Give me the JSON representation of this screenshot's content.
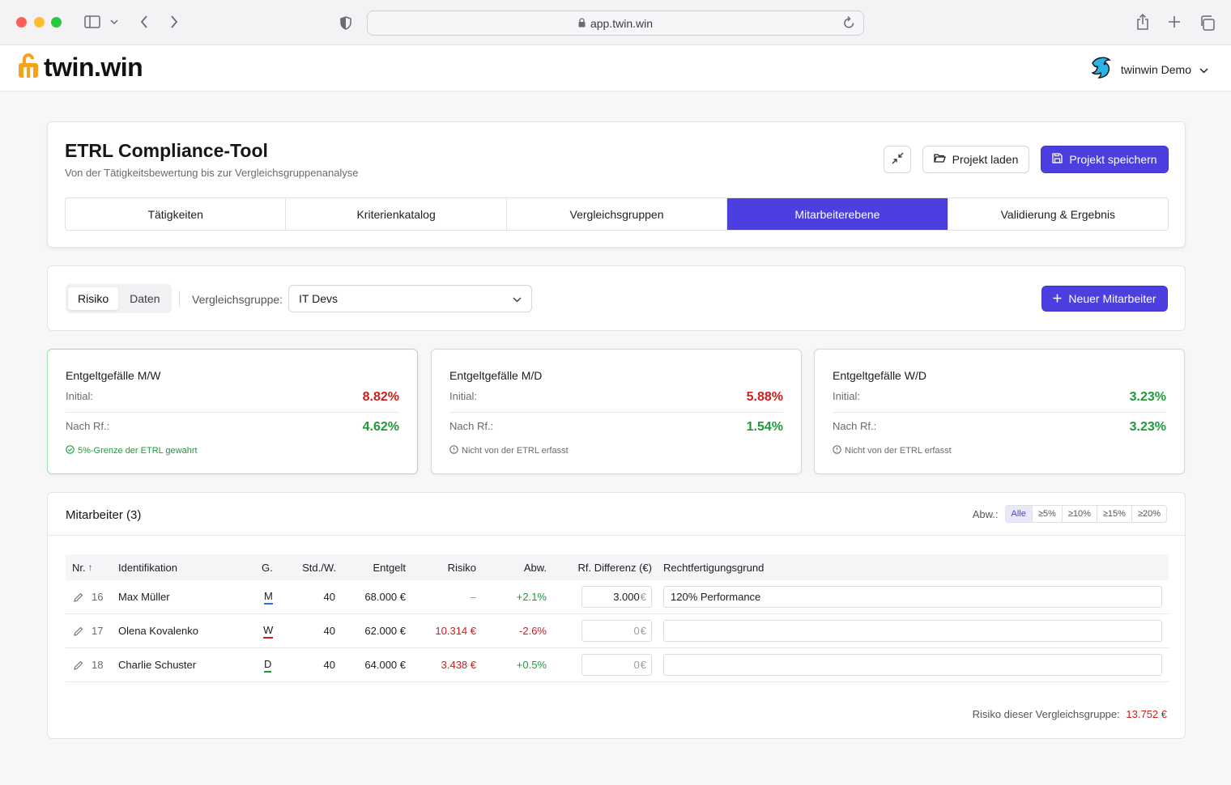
{
  "browser": {
    "url": "app.twin.win"
  },
  "app": {
    "logo_text": "twin.win",
    "user_name": "twinwin Demo"
  },
  "tool": {
    "title": "ETRL Compliance-Tool",
    "subtitle": "Von der Tätigkeitsbewertung bis zur Vergleichsgruppenanalyse",
    "load_label": "Projekt laden",
    "save_label": "Projekt speichern",
    "tabs": [
      "Tätigkeiten",
      "Kriterienkatalog",
      "Vergleichsgruppen",
      "Mitarbeiterebene",
      "Validierung & Ergebnis"
    ],
    "active_tab": "Mitarbeiterebene"
  },
  "controls": {
    "seg_risk": "Risiko",
    "seg_data": "Daten",
    "group_label": "Vergleichsgruppe:",
    "group_value": "IT Devs",
    "new_employee": "Neuer Mitarbeiter"
  },
  "kpis": [
    {
      "title": "Entgeltgefälle M/W",
      "initial_label": "Initial:",
      "initial_value": "8.82%",
      "after_label": "Nach Rf.:",
      "after_value": "4.62%",
      "note": "5%-Grenze der ETRL gewahrt"
    },
    {
      "title": "Entgeltgefälle M/D",
      "initial_label": "Initial:",
      "initial_value": "5.88%",
      "after_label": "Nach Rf.:",
      "after_value": "1.54%",
      "note": "Nicht von der ETRL erfasst"
    },
    {
      "title": "Entgeltgefälle W/D",
      "initial_label": "Initial:",
      "initial_value": "3.23%",
      "after_label": "Nach Rf.:",
      "after_value": "3.23%",
      "note": "Nicht von der ETRL erfasst"
    }
  ],
  "colors": {
    "accent": "#4c3fe0",
    "danger": "#d11c1c",
    "success": "#1f9a3b"
  },
  "employees": {
    "title": "Mitarbeiter (3)",
    "filter_label": "Abw.:",
    "filters": [
      "Alle",
      "≥5%",
      "≥10%",
      "≥15%",
      "≥20%"
    ],
    "headers": {
      "nr": "Nr.",
      "sort": "↑",
      "id": "Identifikation",
      "g": "G.",
      "hours": "Std./W.",
      "pay": "Entgelt",
      "risk": "Risiko",
      "dev": "Abw.",
      "rf": "Rf. Differenz (€)",
      "reason": "Rechtfertigungsgrund"
    },
    "rows": [
      {
        "nr": "16",
        "name": "Max Müller",
        "g": "M",
        "hours": "40",
        "pay": "68.000 €",
        "risk": "–",
        "dev": "+2.1%",
        "rf": "3.000",
        "rf_unit": "€",
        "reason": "120% Performance"
      },
      {
        "nr": "17",
        "name": "Olena Kovalenko",
        "g": "W",
        "hours": "40",
        "pay": "62.000 €",
        "risk": "10.314 €",
        "dev": "-2.6%",
        "rf": "0",
        "rf_unit": "€",
        "reason": ""
      },
      {
        "nr": "18",
        "name": "Charlie Schuster",
        "g": "D",
        "hours": "40",
        "pay": "64.000 €",
        "risk": "3.438 €",
        "dev": "+0.5%",
        "rf": "0",
        "rf_unit": "€",
        "reason": ""
      }
    ],
    "footer_label": "Risiko dieser Vergleichsgruppe:",
    "footer_value": "13.752 €"
  }
}
